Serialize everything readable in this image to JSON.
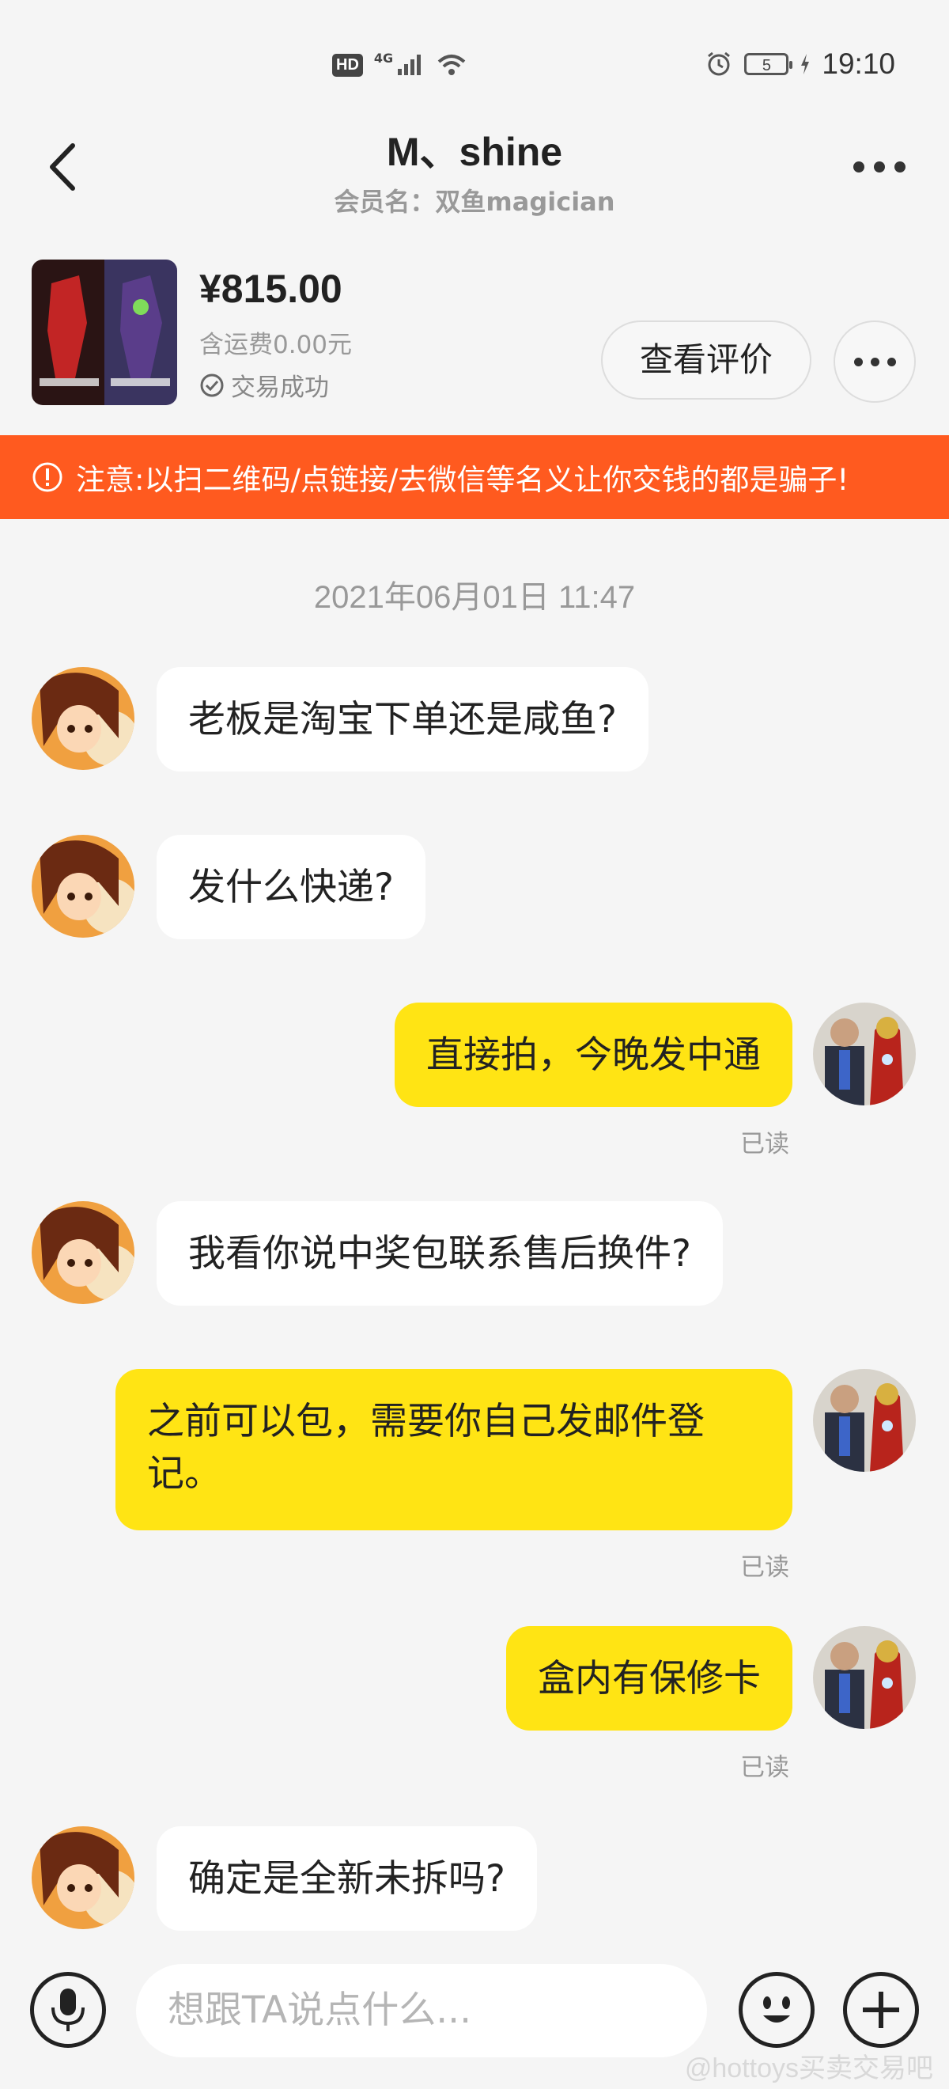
{
  "status_bar": {
    "hd": "HD",
    "network": "4G",
    "battery": "5",
    "time": "19:10"
  },
  "header": {
    "title": "M、shine",
    "subtitle": "会员名：双鱼magician"
  },
  "product": {
    "price": "¥815.00",
    "shipping": "含运费0.00元",
    "status": "交易成功",
    "review_button": "查看评价"
  },
  "warning": {
    "text": "注意:以扫二维码/点链接/去微信等名义让你交钱的都是骗子!"
  },
  "chat": {
    "timestamp": "2021年06月01日 11:47",
    "messages": [
      {
        "from": "other",
        "text": "老板是淘宝下单还是咸鱼?"
      },
      {
        "from": "other",
        "text": "发什么快递?"
      },
      {
        "from": "me",
        "text": "直接拍，今晚发中通",
        "status": "已读"
      },
      {
        "from": "other",
        "text": "我看你说中奖包联系售后换件?"
      },
      {
        "from": "me",
        "text": "之前可以包，需要你自己发邮件登记。",
        "status": "已读"
      },
      {
        "from": "me",
        "text": "盒内有保修卡",
        "status": "已读"
      },
      {
        "from": "other",
        "text": "确定是全新未拆吗?"
      }
    ]
  },
  "input": {
    "placeholder": "想跟TA说点什么..."
  },
  "watermark": "@hottoys买卖交易吧",
  "colors": {
    "warning_bg": "#ff5a1f",
    "my_bubble": "#ffe414",
    "other_bubble": "#ffffff",
    "background": "#f5f5f5"
  }
}
